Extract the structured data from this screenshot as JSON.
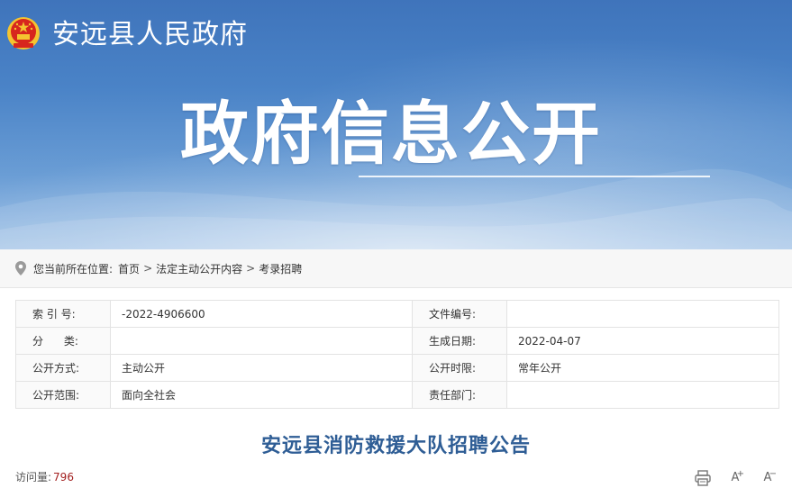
{
  "site": {
    "title": "安远县人民政府"
  },
  "banner": {
    "heading": "政府信息公开"
  },
  "breadcrumb": {
    "prefix": "您当前所在位置:",
    "items": [
      "首页",
      "法定主动公开内容",
      "考录招聘"
    ],
    "separator": ">"
  },
  "meta": {
    "rows": [
      {
        "label1": "索 引 号:",
        "value1": "-2022-4906600",
        "label2": "文件编号:",
        "value2": ""
      },
      {
        "label1": "分      类:",
        "value1": "",
        "label2": "生成日期:",
        "value2": "2022-04-07"
      },
      {
        "label1": "公开方式:",
        "value1": "主动公开",
        "label2": "公开时限:",
        "value2": "常年公开"
      },
      {
        "label1": "公开范围:",
        "value1": "面向全社会",
        "label2": "责任部门:",
        "value2": ""
      }
    ]
  },
  "article": {
    "title": "安远县消防救援大队招聘公告"
  },
  "stats": {
    "visits_label": "访问量:",
    "visits_value": "796"
  },
  "tools": {
    "print_icon": "printer-icon",
    "zoom_in_label": "A",
    "zoom_out_label": "A"
  },
  "colors": {
    "banner_blue": "#3f74bb",
    "title_blue": "#2e5d95",
    "count_red": "#a32020"
  }
}
